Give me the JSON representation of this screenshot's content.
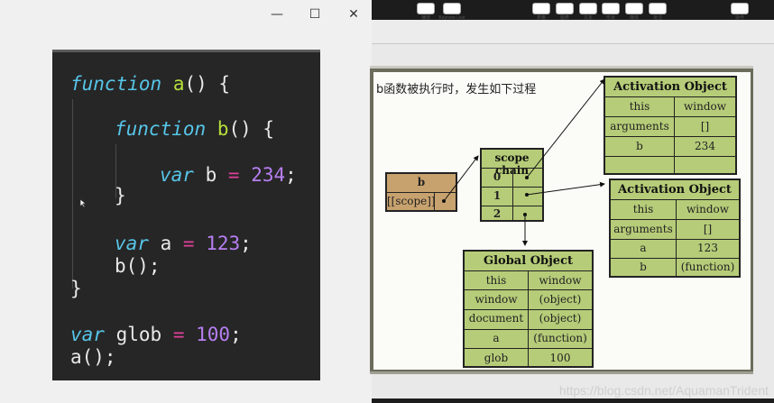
{
  "window_controls": {
    "minimize": "—",
    "maximize": "☐",
    "close": "✕"
  },
  "code": {
    "l1": {
      "kw": "function",
      "name": "a",
      "rest": "() {"
    },
    "l2": {
      "kw": "function",
      "name": "b",
      "rest": "() {"
    },
    "l3": {
      "kw": "var",
      "id": "b",
      "op": "=",
      "num": "234",
      "end": ";"
    },
    "l4": "}",
    "l5": {
      "kw": "var",
      "id": "a",
      "op": "=",
      "num": "123",
      "end": ";"
    },
    "l6": "b();",
    "l7": "}",
    "l8": {
      "kw": "var",
      "id": "glob",
      "op": "=",
      "num": "100",
      "end": ";"
    },
    "l9": "a();"
  },
  "toolbar": {
    "play": "播放",
    "keynote_live": "Keynote Live",
    "table": "表格",
    "chart": "图表",
    "text": "文本",
    "shape": "形状",
    "media": "媒体",
    "comment": "批注",
    "collaborate": "协作"
  },
  "slide": {
    "heading": "b函数被执行时，发生如下过程",
    "b_box": {
      "title": "b",
      "scope": "[[scope]]"
    },
    "scope_chain": {
      "title": "scope chain",
      "rows": [
        "0",
        "1",
        "2"
      ]
    },
    "ao1": {
      "title": "Activation Object",
      "rows": [
        [
          "this",
          "window"
        ],
        [
          "arguments",
          "[]"
        ],
        [
          "b",
          "234"
        ],
        [
          "",
          ""
        ]
      ]
    },
    "ao2": {
      "title": "Activation Object",
      "rows": [
        [
          "this",
          "window"
        ],
        [
          "arguments",
          "[]"
        ],
        [
          "a",
          "123"
        ],
        [
          "b",
          "(function)"
        ]
      ]
    },
    "go": {
      "title": "Global Object",
      "rows": [
        [
          "this",
          "window"
        ],
        [
          "window",
          "(object)"
        ],
        [
          "document",
          "(object)"
        ],
        [
          "a",
          "(function)"
        ],
        [
          "glob",
          "100"
        ]
      ]
    }
  },
  "watermark": "https://blog.csdn.net/AquamanTrident",
  "colors": {
    "table_fill": "#b6cc78",
    "b_box_fill": "#c8a26e",
    "code_bg": "#262626"
  }
}
